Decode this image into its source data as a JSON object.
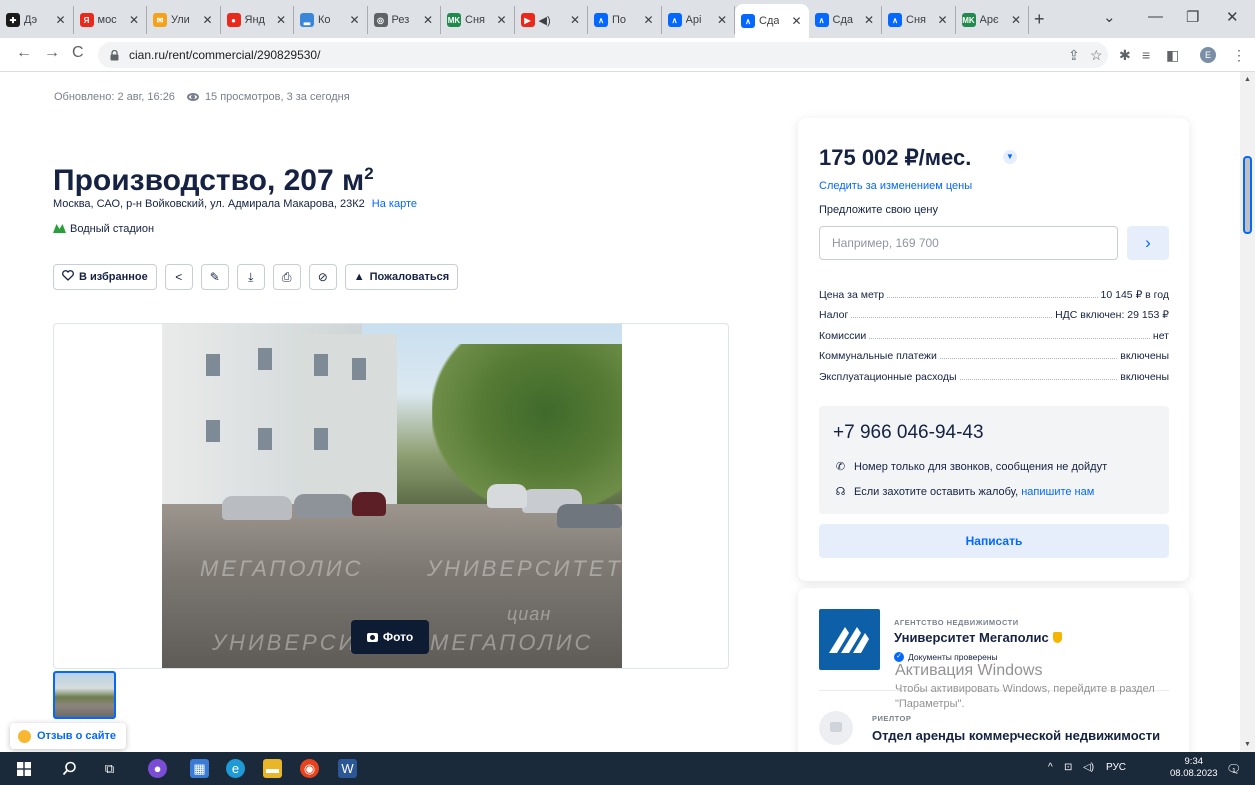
{
  "browser": {
    "tabs": [
      {
        "label": "Дэ",
        "fav_color": "#1a1a1a",
        "fav_text": "✚"
      },
      {
        "label": "мос",
        "fav_color": "#e8291c",
        "fav_text": "Я"
      },
      {
        "label": "Ули",
        "fav_color": "#f4a21c",
        "fav_text": "✉"
      },
      {
        "label": "Янд",
        "fav_color": "#e8291c",
        "fav_text": "●"
      },
      {
        "label": "Ко",
        "fav_color": "#3a86d9",
        "fav_text": "▂"
      },
      {
        "label": "Рез",
        "fav_color": "#5f6368",
        "fav_text": "◎"
      },
      {
        "label": "Сня",
        "fav_color": "#1f8a4c",
        "fav_text": "MK"
      },
      {
        "label": "◀)",
        "fav_color": "#e8291c",
        "fav_text": "▶"
      },
      {
        "label": "По",
        "fav_color": "#0468ff",
        "fav_text": "∧"
      },
      {
        "label": "Арі",
        "fav_color": "#0468ff",
        "fav_text": "∧"
      },
      {
        "label": "Сда",
        "fav_color": "#0468ff",
        "fav_text": "∧"
      },
      {
        "label": "Сда",
        "fav_color": "#0468ff",
        "fav_text": "∧"
      },
      {
        "label": "Сня",
        "fav_color": "#0468ff",
        "fav_text": "∧"
      },
      {
        "label": "Арє",
        "fav_color": "#1f8a4c",
        "fav_text": "MK"
      }
    ],
    "active_tab_index": 10,
    "url": "cian.ru/rent/commercial/290829530/",
    "profile_initial": "E"
  },
  "listing": {
    "updated": "Обновлено: 2 авг, 16:26",
    "views": "15 просмотров, 3 за сегодня",
    "title": "Производство, 207 м",
    "title_sup": "2",
    "address": "Москва, САО, р-н Войковский, ул. Адмирала Макарова, 23К2",
    "map_link": "На карте",
    "metro": "Водный стадион",
    "favorite_label": "В избранное",
    "complain_label": "Пожаловаться",
    "photo_button": "Фото",
    "watermark_1": "МЕГАПОЛИС",
    "watermark_2": "УНИВЕРСИТЕТ",
    "watermark_3": "УНИВЕРСИТЕТ",
    "watermark_4": "МЕГАПОЛИС",
    "watermark_5": "циан"
  },
  "price_card": {
    "price": "175 002 ₽/мес.",
    "follow_price": "Следить за изменением цены",
    "offer_label": "Предложите свою цену",
    "offer_placeholder": "Например, 169 700",
    "facts": [
      {
        "label": "Цена за метр",
        "value": "10 145 ₽ в год"
      },
      {
        "label": "Налог",
        "value": "НДС включен: 29 153 ₽"
      },
      {
        "label": "Комиссии",
        "value": "нет"
      },
      {
        "label": "Коммунальные платежи",
        "value": "включены"
      },
      {
        "label": "Эксплуатационные расходы",
        "value": "включены"
      }
    ],
    "phone": "+7 966 046-94-43",
    "note_calls": "Номер только для звонков, сообщения не дойдут",
    "note_complaint": "Если захотите оставить жалобу,",
    "note_complaint_link": "напишите нам",
    "write_button": "Написать"
  },
  "agency": {
    "kicker": "АГЕНТСТВО НЕДВИЖИМОСТИ",
    "name": "Университет Мегаполис",
    "verified": "Документы проверены",
    "realtor_kicker": "РИЕЛТОР",
    "realtor_name": "Отдел аренды коммерческой недвижимости"
  },
  "feedback": "Отзыв о сайте",
  "windows_activation": {
    "title": "Активация Windows",
    "text": "Чтобы активировать Windows, перейдите в раздел \"Параметры\"."
  },
  "taskbar": {
    "lang": "РУС",
    "time": "9:34",
    "date": "08.08.2023",
    "notifications": "1"
  }
}
